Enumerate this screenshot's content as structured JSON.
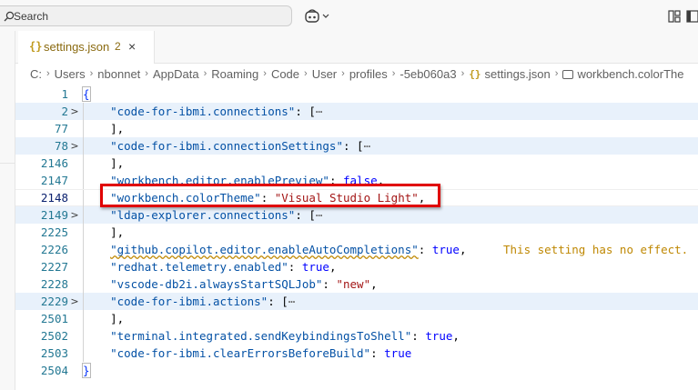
{
  "titlebar": {
    "search_label": "Search"
  },
  "tab": {
    "icon": "{}",
    "title": "settings.json",
    "problem_count": "2",
    "close": "×"
  },
  "breadcrumb": {
    "items": [
      "C:",
      "Users",
      "nbonnet",
      "AppData",
      "Roaming",
      "Code",
      "User",
      "profiles",
      "-5eb060a3"
    ],
    "file": "settings.json",
    "symbol": "workbench.colorThe"
  },
  "editor": {
    "lines": [
      {
        "num": "1",
        "fold": "",
        "code": "{"
      },
      {
        "num": "2",
        "fold": ">",
        "key": "\"code-for-ibmi.connections\"",
        "after": ": [",
        "ellipsis": "⋯"
      },
      {
        "num": "77",
        "fold": "",
        "code": "],"
      },
      {
        "num": "78",
        "fold": ">",
        "key": "\"code-for-ibmi.connectionSettings\"",
        "after": ": [",
        "ellipsis": "⋯"
      },
      {
        "num": "2146",
        "fold": "",
        "code": "],"
      },
      {
        "num": "2147",
        "fold": "",
        "key": "\"workbench.editor.enablePreview\"",
        "after": ": ",
        "bool": "false",
        "tail": ","
      },
      {
        "num": "2148",
        "fold": "",
        "key": "\"workbench.colorTheme\"",
        "after": ": ",
        "str": "\"Visual Studio Light\"",
        "tail": ","
      },
      {
        "num": "2149",
        "fold": ">",
        "key": "\"ldap-explorer.connections\"",
        "after": ": [",
        "ellipsis": "⋯"
      },
      {
        "num": "2225",
        "fold": "",
        "code": "],"
      },
      {
        "num": "2226",
        "fold": "",
        "key": "\"github.copilot.editor.enableAutoCompletions\"",
        "after": ": ",
        "bool": "true",
        "tail": ",",
        "hint": "This setting has no effect."
      },
      {
        "num": "2227",
        "fold": "",
        "key": "\"redhat.telemetry.enabled\"",
        "after": ": ",
        "bool": "true",
        "tail": ","
      },
      {
        "num": "2228",
        "fold": "",
        "key": "\"vscode-db2i.alwaysStartSQLJob\"",
        "after": ": ",
        "str": "\"new\"",
        "tail": ","
      },
      {
        "num": "2229",
        "fold": ">",
        "key": "\"code-for-ibmi.actions\"",
        "after": ": [",
        "ellipsis": "⋯"
      },
      {
        "num": "2501",
        "fold": "",
        "code": "],"
      },
      {
        "num": "2502",
        "fold": "",
        "key": "\"terminal.integrated.sendKeybindingsToShell\"",
        "after": ": ",
        "bool": "true",
        "tail": ","
      },
      {
        "num": "2503",
        "fold": "",
        "key": "\"code-for-ibmi.clearErrorsBeforeBuild\"",
        "after": ": ",
        "bool": "true",
        "tail": ""
      },
      {
        "num": "2504",
        "fold": "",
        "code": "}"
      }
    ]
  },
  "colors": {
    "key": "#0451a5",
    "string": "#a31515",
    "keyword": "#0000ff",
    "warning": "#bf8803",
    "highlight_box": "#e00000"
  }
}
